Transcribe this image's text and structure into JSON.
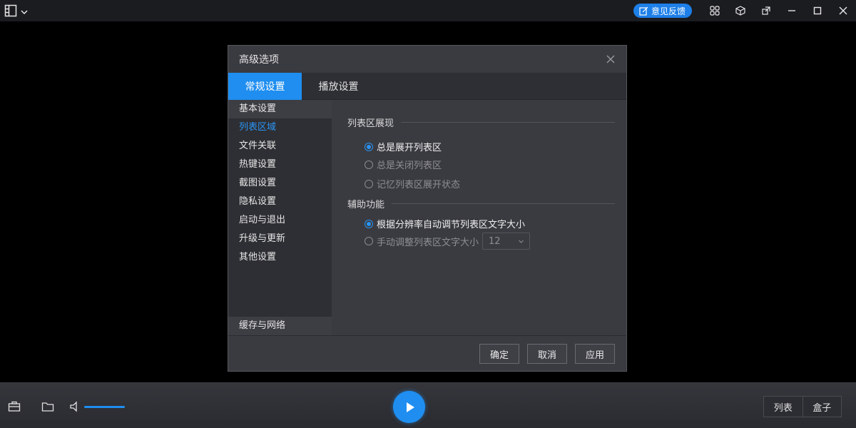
{
  "topbar": {
    "feedback_label": "意见反馈"
  },
  "dialog": {
    "title": "高级选项",
    "tabs": [
      {
        "label": "常规设置",
        "active": true
      },
      {
        "label": "播放设置",
        "active": false
      }
    ],
    "nav": {
      "items": [
        {
          "label": "基本设置"
        },
        {
          "label": "列表区域"
        },
        {
          "label": "文件关联"
        },
        {
          "label": "热键设置"
        },
        {
          "label": "截图设置"
        },
        {
          "label": "隐私设置"
        },
        {
          "label": "启动与退出"
        },
        {
          "label": "升级与更新"
        },
        {
          "label": "其他设置"
        }
      ],
      "bottom_item": "缓存与网络"
    },
    "panel": {
      "section1": {
        "title": "列表区展现",
        "options": [
          "总是展开列表区",
          "总是关闭列表区",
          "记忆列表区展开状态"
        ]
      },
      "section2": {
        "title": "辅助功能",
        "options": [
          "根据分辨率自动调节列表区文字大小",
          "手动调整列表区文字大小"
        ],
        "font_size_value": "12"
      }
    },
    "buttons": {
      "ok": "确定",
      "cancel": "取消",
      "apply": "应用"
    }
  },
  "bottombar": {
    "list_label": "列表",
    "box_label": "盒子"
  },
  "colors": {
    "accent": "#1f8ef0",
    "active_nav_text": "#2a94f4",
    "dialog_bg": "#3a3b41"
  }
}
